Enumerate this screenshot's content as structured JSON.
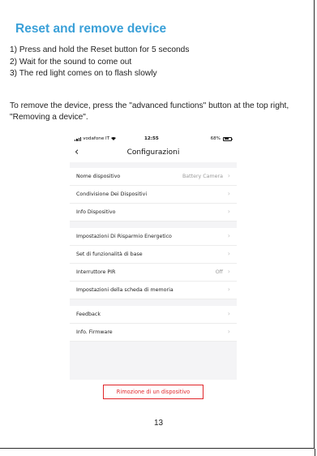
{
  "document": {
    "title": "Reset and remove device",
    "steps": [
      "1) Press and hold the Reset button for 5 seconds",
      "2) Wait for the sound to come out",
      "3) The red light comes on to flash slowly"
    ],
    "remove_note": "To remove the device, press the \"advanced functions\" button at the top right, \"Removing a device\".",
    "page_number": "13"
  },
  "phone": {
    "status_bar": {
      "carrier": "vodafone IT",
      "time": "12:55",
      "battery": "68%"
    },
    "nav": {
      "back_icon": "chevron-left-icon",
      "back_glyph": "‹",
      "title": "Configurazioni"
    },
    "rows": [
      {
        "label": "Nome dispositivo",
        "value": "Battery Camera",
        "chevron": "›"
      },
      {
        "label": "Condivisione Dei Dispositivi",
        "value": "",
        "chevron": "›"
      },
      {
        "label": "Info Dispositivo",
        "value": "",
        "chevron": "›"
      },
      {
        "label": "Impostazioni Di Risparmio Energetico",
        "value": "",
        "chevron": "›"
      },
      {
        "label": "Set di funzionalità di base",
        "value": "",
        "chevron": "›"
      },
      {
        "label": "Interruttore PIR",
        "value": "Off",
        "chevron": "›"
      },
      {
        "label": "Impostazioni della scheda di memoria",
        "value": "",
        "chevron": "›"
      },
      {
        "label": "Feedback",
        "value": "",
        "chevron": "›"
      },
      {
        "label": "Info. Firmware",
        "value": "",
        "chevron": "›"
      }
    ],
    "remove_button": "Rimozione di un dispositivo",
    "accent_color": "#e0262a"
  },
  "colors": {
    "title": "#3aa0d8"
  }
}
